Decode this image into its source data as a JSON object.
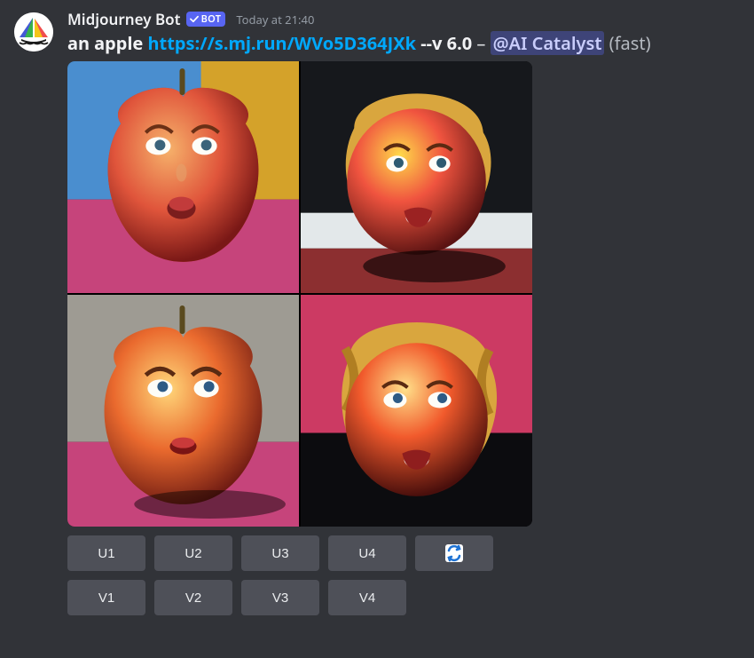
{
  "header": {
    "username": "Midjourney Bot",
    "bot_badge": "BOT",
    "timestamp": "Today at 21:40"
  },
  "prompt": {
    "text": "an apple",
    "link": "https://s.mj.run/WVo5D364JXk",
    "version": "--v 6.0",
    "separator": "–",
    "mention": "@AI Catalyst",
    "suffix": "(fast)"
  },
  "buttons": {
    "row1": [
      "U1",
      "U2",
      "U3",
      "U4"
    ],
    "reroll": "reroll",
    "row2": [
      "V1",
      "V2",
      "V3",
      "V4"
    ]
  }
}
